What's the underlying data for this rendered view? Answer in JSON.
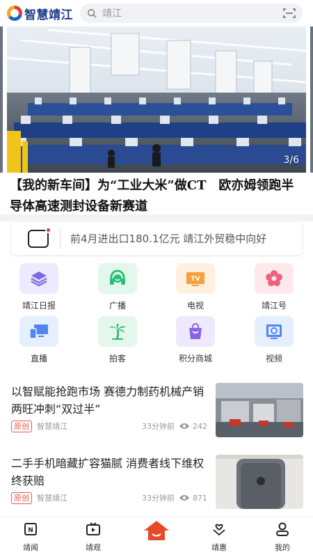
{
  "app": {
    "name": "智慧靖江"
  },
  "search": {
    "placeholder": "靖江"
  },
  "banner": {
    "counter": "3/6",
    "headline": "【我的新车间】为“工业大米”做CT　欧亦姆领跑半导体高速测封设备新赛道"
  },
  "notice": {
    "text": "前4月进出口180.1亿元 靖江外贸稳中向好"
  },
  "grid": [
    {
      "label": "靖江日报",
      "icon": "layers-icon",
      "bg": "#eceafd",
      "color": "#7b6be6"
    },
    {
      "label": "广播",
      "icon": "headset-icon",
      "bg": "#e4f7ec",
      "color": "#27c07a"
    },
    {
      "label": "电视",
      "icon": "tv-icon",
      "bg": "#fff0e0",
      "color": "#f6a13c"
    },
    {
      "label": "靖江号",
      "icon": "flower-icon",
      "bg": "#fde9ec",
      "color": "#f0607a"
    },
    {
      "label": "直播",
      "icon": "monitor-icon",
      "bg": "#e6efff",
      "color": "#4f86ef"
    },
    {
      "label": "拍客",
      "icon": "palm-tree-icon",
      "bg": "#e4f7ec",
      "color": "#27b873"
    },
    {
      "label": "积分商城",
      "icon": "shopping-bag-icon",
      "bg": "#efe9fd",
      "color": "#8a63e8"
    },
    {
      "label": "视频",
      "icon": "video-icon",
      "bg": "#e6efff",
      "color": "#4f86ef"
    }
  ],
  "news": [
    {
      "title": "以智赋能抢跑市场 赛德力制药机械产销两旺冲刺“双过半”",
      "badge": "原创",
      "source": "智慧靖江",
      "time": "33分钟前",
      "views": "242"
    },
    {
      "title": "二手手机暗藏扩容猫腻 消费者线下维权终获赔",
      "badge": "原创",
      "source": "智慧靖江",
      "time": "33分钟前",
      "views": "871"
    }
  ],
  "tabs": [
    {
      "label": "靖闻",
      "icon": "news-icon"
    },
    {
      "label": "靖观",
      "icon": "tv-play-icon"
    },
    {
      "label": "",
      "icon": "home-icon",
      "accent": "#e8492a"
    },
    {
      "label": "靖惠",
      "icon": "heart-hands-icon"
    },
    {
      "label": "我的",
      "icon": "profile-icon"
    }
  ]
}
